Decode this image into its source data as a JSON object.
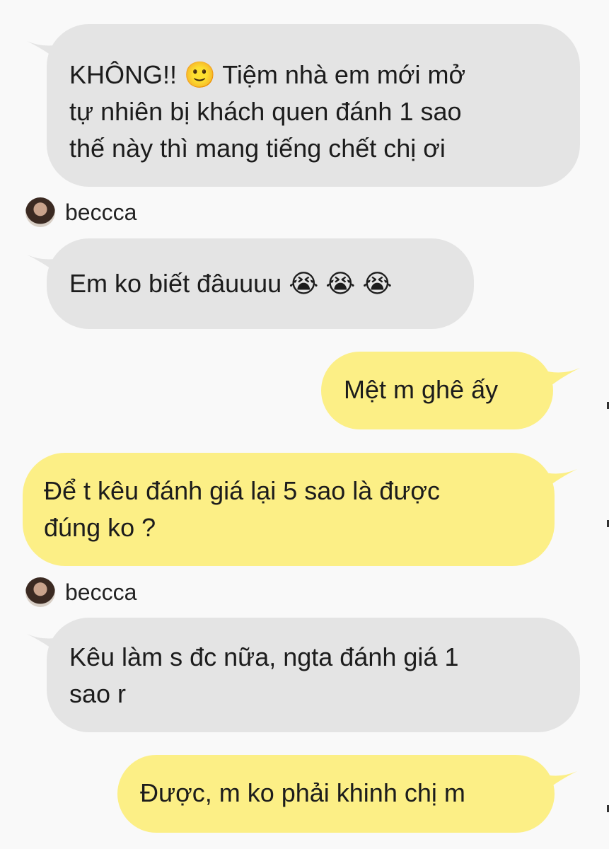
{
  "messages": [
    {
      "id": "m1",
      "direction": "incoming",
      "text": "KHÔNG!! 🙂 Tiệm nhà em mới mở\ntự nhiên bị khách quen đánh 1 sao\nthế này thì mang tiếng chết chị ơi"
    },
    {
      "id": "m2",
      "direction": "incoming",
      "sender": "beccca",
      "text": "Em ko biết đâuuuu 😭 😭 😭"
    },
    {
      "id": "m3",
      "direction": "outgoing",
      "text": "Mệt m ghê ấy"
    },
    {
      "id": "m4",
      "direction": "outgoing",
      "text": "Để t kêu đánh giá lại 5 sao là được\nđúng ko ?"
    },
    {
      "id": "m5",
      "direction": "incoming",
      "sender": "beccca",
      "text": "Kêu làm s đc nữa, ngta đánh giá 1\nsao r"
    },
    {
      "id": "m6",
      "direction": "outgoing",
      "text": "Được, m ko phải khinh chị m"
    }
  ],
  "colors": {
    "background": "#f9f9f9",
    "incoming_bubble": "#e4e4e4",
    "outgoing_bubble": "#fcef86",
    "text": "#1c1c1c"
  }
}
